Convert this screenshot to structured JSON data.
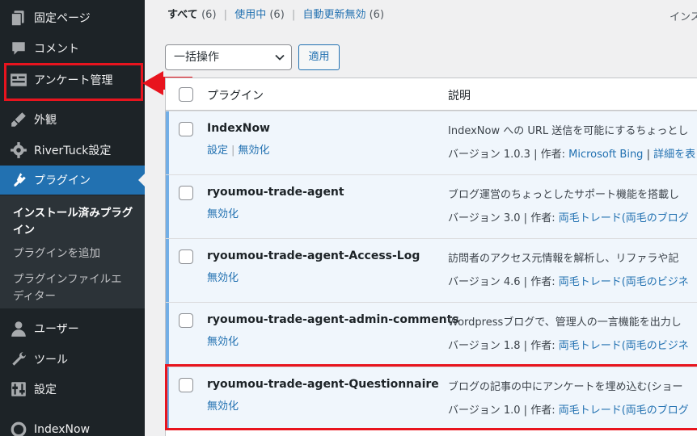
{
  "sidebar": {
    "items": [
      {
        "label": "固定ページ",
        "icon": "pages-icon"
      },
      {
        "label": "コメント",
        "icon": "comment-icon"
      },
      {
        "label": "アンケート管理",
        "icon": "form-icon"
      },
      {
        "label": "外観",
        "icon": "brush-icon"
      },
      {
        "label": "RiverTuck設定",
        "icon": "gear-icon"
      },
      {
        "label": "プラグイン",
        "icon": "plugin-icon"
      },
      {
        "label": "ユーザー",
        "icon": "user-icon"
      },
      {
        "label": "ツール",
        "icon": "wrench-icon"
      },
      {
        "label": "設定",
        "icon": "settings-icon"
      },
      {
        "label": "IndexNow",
        "icon": "indexnow-icon"
      }
    ],
    "submenu": [
      {
        "label": "インストール済みプラグイン"
      },
      {
        "label": "プラグインを追加"
      },
      {
        "label": "プラグインファイルエディター"
      }
    ]
  },
  "filters": {
    "all": {
      "label": "すべて",
      "count": "(6)"
    },
    "active": {
      "label": "使用中",
      "count": "(6)"
    },
    "autoupdate": {
      "label": "自動更新無効",
      "count": "(6)"
    },
    "separator": "|"
  },
  "header_right": "インス",
  "bulk": {
    "selected": "一括操作",
    "apply": "適用"
  },
  "table": {
    "col_plugin": "プラグイン",
    "col_desc": "説明",
    "rows": [
      {
        "name": "IndexNow",
        "actions": [
          "設定",
          "無効化"
        ],
        "description": "IndexNow への URL 送信を可能にするちょっとし",
        "version": "バージョン 1.0.3 | 作者:",
        "author": "Microsoft Bing",
        "extra": "詳細を表"
      },
      {
        "name": "ryoumou-trade-agent",
        "actions": [
          "無効化"
        ],
        "description": "ブログ運営のちょっとしたサポート機能を搭載し",
        "version": "バージョン 3.0 | 作者:",
        "author": "両毛トレード(両毛のブログ"
      },
      {
        "name": "ryoumou-trade-agent-Access-Log",
        "actions": [
          "無効化"
        ],
        "description": "訪問者のアクセス元情報を解析し、リファラや記",
        "version": "バージョン 4.6 | 作者:",
        "author": "両毛トレード(両毛のビジネ"
      },
      {
        "name": "ryoumou-trade-agent-admin-comments",
        "actions": [
          "無効化"
        ],
        "description": "Wordpressブログで、管理人の一言機能を出力し",
        "version": "バージョン 1.8 | 作者:",
        "author": "両毛トレード(両毛のビジネ"
      },
      {
        "name": "ryoumou-trade-agent-Questionnaire",
        "actions": [
          "無効化"
        ],
        "description": "ブログの記事の中にアンケートを埋め込む(ショー",
        "version": "バージョン 1.0 | 作者:",
        "author": "両毛トレード(両毛のブログ"
      }
    ]
  },
  "colors": {
    "accent": "#2271b1",
    "highlight": "#e8141e",
    "sidebar": "#1d2327",
    "active_row": "#f0f6fc"
  }
}
